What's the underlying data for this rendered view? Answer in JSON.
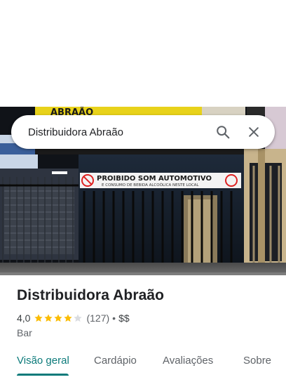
{
  "search": {
    "query": "Distribuidora Abraão"
  },
  "photo": {
    "storefront_sign": "ABRAÃO",
    "banner_line1": "PROIBIDO SOM AUTOMOTIVO",
    "banner_line2": "E CONSUMO DE BEBIDA ALCOÓLICA NESTE LOCAL"
  },
  "place": {
    "name": "Distribuidora Abraão",
    "rating": "4,0",
    "stars_filled": 4,
    "stars_total": 5,
    "review_count": "(127)",
    "separator": "•",
    "price_level": "$$",
    "category": "Bar"
  },
  "tabs": [
    {
      "label": "Visão geral",
      "active": true
    },
    {
      "label": "Cardápio",
      "active": false
    },
    {
      "label": "Avaliações",
      "active": false
    },
    {
      "label": "Sobre",
      "active": false
    }
  ],
  "colors": {
    "accent": "#0b7a7a",
    "star": "#fbbc04",
    "star_empty": "#dadce0"
  }
}
